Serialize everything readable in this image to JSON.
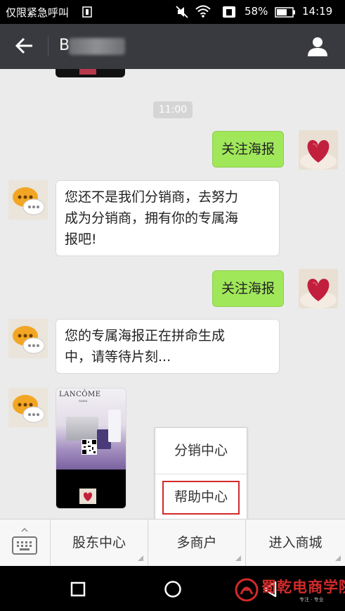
{
  "status_bar": {
    "carrier": "仅限紧急呼叫",
    "battery": "58%",
    "time": "14:19"
  },
  "header": {
    "title": "B"
  },
  "chat": {
    "timestamp": "11:00",
    "messages": [
      {
        "from": "me",
        "text": "关注海报"
      },
      {
        "from": "other",
        "lines": [
          "您还不是我们分销商，去努力",
          "成为分销商，拥有你的专属海",
          "报吧!"
        ]
      },
      {
        "from": "me",
        "text": "关注海报"
      },
      {
        "from": "other",
        "lines": [
          "您的专属海报正在拼命生成",
          "中，请等待片刻..."
        ]
      },
      {
        "from": "other",
        "type": "image",
        "brand": "LANCÔME",
        "brand_sub": "PARIS"
      }
    ]
  },
  "popup_menu": {
    "items": [
      "分销中心",
      "帮助中心"
    ],
    "highlighted": "帮助中心",
    "highlight_color": "#d22a2a"
  },
  "bottom_menu": {
    "items": [
      "股东中心",
      "多商户",
      "进入商城"
    ]
  },
  "watermark": {
    "name": "蜀乾电商学院",
    "tagline": "专注 · 专业"
  },
  "colors": {
    "status_bar": "#000000",
    "title_bar": "#393a3f",
    "chat_bg": "#ebebeb",
    "my_bubble": "#a0e75a",
    "other_bubble": "#ffffff"
  }
}
